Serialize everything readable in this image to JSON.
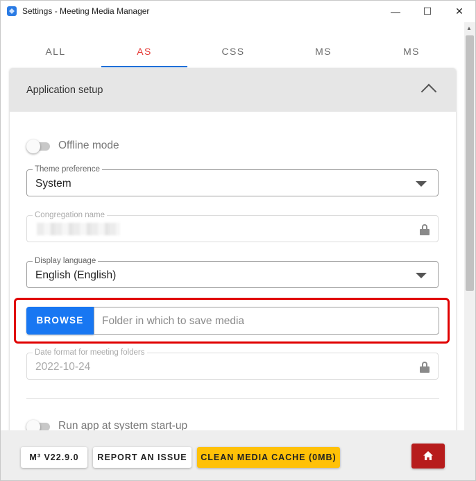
{
  "window": {
    "title": "Settings - Meeting Media Manager",
    "minimize_glyph": "—",
    "maximize_glyph": "☐",
    "close_glyph": "✕"
  },
  "tabs": [
    {
      "label": "ALL",
      "active": false
    },
    {
      "label": "AS",
      "active": true
    },
    {
      "label": "CSS",
      "active": false
    },
    {
      "label": "MS",
      "active": false
    },
    {
      "label": "MS",
      "active": false
    }
  ],
  "section": {
    "title": "Application setup",
    "collapse_icon": "chevron-up-icon"
  },
  "offline_mode": {
    "label": "Offline mode",
    "enabled": false
  },
  "theme": {
    "legend": "Theme preference",
    "value": "System"
  },
  "congregation": {
    "legend": "Congregation name",
    "value_redacted": true
  },
  "language": {
    "legend": "Display language",
    "value": "English (English)"
  },
  "media_folder": {
    "button_label": "BROWSE",
    "placeholder": "Folder in which to save media"
  },
  "date_format": {
    "legend": "Date format for meeting folders",
    "value": "2022-10-24"
  },
  "run_at_startup": {
    "label": "Run app at system start-up",
    "enabled": false
  },
  "footer": {
    "version_label": "M³ V22.9.0",
    "report_label": "REPORT AN ISSUE",
    "clean_cache_label": "CLEAN MEDIA CACHE (0MB)",
    "home_icon": "home-icon"
  },
  "colors": {
    "active_tab": "#e53935",
    "tab_indicator": "#1e6fd9",
    "browse_button": "#1877f2",
    "clean_cache_button": "#ffc107",
    "home_button": "#b71c1c",
    "highlight_box": "#e00000"
  }
}
